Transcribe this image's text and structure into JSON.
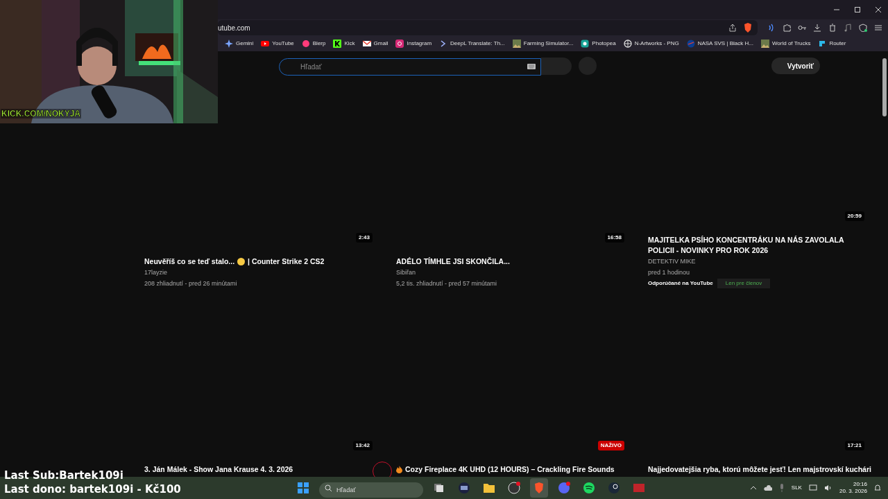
{
  "browser": {
    "address": "utube.com",
    "bookmarks": [
      {
        "label": "Gemini"
      },
      {
        "label": "YouTube"
      },
      {
        "label": "Blerp"
      },
      {
        "label": "Kick"
      },
      {
        "label": "Gmail"
      },
      {
        "label": "Instagram"
      },
      {
        "label": "DeepL Translate: Th..."
      },
      {
        "label": "Farming Simulator..."
      },
      {
        "label": "Photopea"
      },
      {
        "label": "N-Artworks - PNG"
      },
      {
        "label": "NASA SVS | Black H..."
      },
      {
        "label": "World of Trucks"
      },
      {
        "label": "Router"
      }
    ]
  },
  "youtube": {
    "search": {
      "placeholder": "Hľadať"
    },
    "create_button": "Vytvoriť",
    "videos": [
      {
        "duration": "2:43",
        "live": false,
        "title": "Neuvěříš co se teď stalo...",
        "title_rest": "| Counter Strike 2 CS2",
        "channel": "17layzie",
        "meta": "208 zhliadnutí - pred 26 minútami"
      },
      {
        "duration": "16:58",
        "live": false,
        "title": "ADÉLO TÍMHLE JSI SKONČILA...",
        "channel": "Sibiřan",
        "meta": "5,2 tis. zhliadnutí - pred 57 minútami"
      },
      {
        "duration": "20:59",
        "live": false,
        "title": "MAJITELKA PSÍHO KONCENTRÁKU NA NÁS ZAVOLALA POLICII - NOVINKY PRO ROK 2026",
        "channel": "DETEKTIV MIKE",
        "meta": "pred 1 hodinou",
        "note": "Odporúčané na YouTube",
        "badge": "Len pre členov"
      },
      {
        "duration": "13:42",
        "live": false,
        "title": "3. Ján Málek - Show Jana Krause 4. 3. 2026"
      },
      {
        "duration": "NAŽIVO",
        "live": true,
        "title": "Cozy Fireplace 4K UHD (12 HOURS) – Crackling Fire Sounds"
      },
      {
        "duration": "17:21",
        "live": false,
        "title": "Najjedovatejšia ryba, ktorú môžete jesť! Len majstrovskí kuchári"
      }
    ]
  },
  "stream_overlay": {
    "handle": "KICK.COM/NOKYJA",
    "last_sub": "Last Sub:Bartek109i",
    "last_dono": "Last dono: bartek109i - Kč100"
  },
  "taskbar": {
    "search": {
      "placeholder": "Hľadať"
    },
    "apps": [
      {
        "active": false
      },
      {
        "active": false
      },
      {
        "active": false
      },
      {
        "active": false
      },
      {
        "active": false
      },
      {
        "active": true
      },
      {
        "active": false
      },
      {
        "active": false
      },
      {
        "active": false
      },
      {
        "active": false
      }
    ],
    "language": "SLK",
    "time": "20:16",
    "date": "20. 3. 2026"
  }
}
